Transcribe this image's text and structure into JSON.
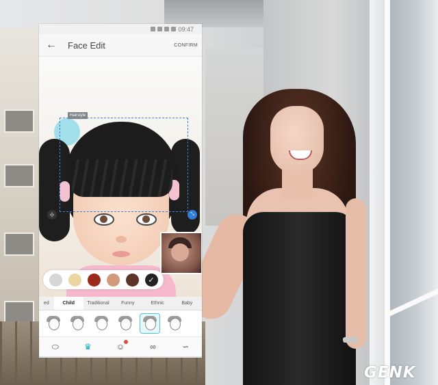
{
  "status_bar": {
    "time": "09:47"
  },
  "app_bar": {
    "back_icon": "←",
    "title": "Face Edit",
    "confirm_label": "CONFIRM"
  },
  "canvas": {
    "selection_label": "Hairstyle",
    "handle_left": "‹|›",
    "handle_right": "⤡"
  },
  "swatches": {
    "colors": [
      "#d6d6d6",
      "#ead7a0",
      "#9c2a1c",
      "#d19a7a",
      "#5c3427"
    ],
    "confirm_icon": "✓"
  },
  "categories": [
    "ed",
    "Child",
    "Traditional",
    "Funny",
    "Ethnic",
    "Baby"
  ],
  "active_category": "Child",
  "styles_active_index": 4,
  "tools": [
    "face-outline-icon",
    "hair-icon",
    "emoji-face-icon",
    "glasses-icon",
    "mustache-icon"
  ],
  "tool_glyphs": [
    "⬭",
    "♛",
    "☺",
    "∞",
    "∽"
  ],
  "nav": {
    "recent_glyph": "⇆",
    "home_glyph": "□",
    "back_glyph": "←",
    "dot_glyph": "•"
  },
  "watermark": "GENK"
}
